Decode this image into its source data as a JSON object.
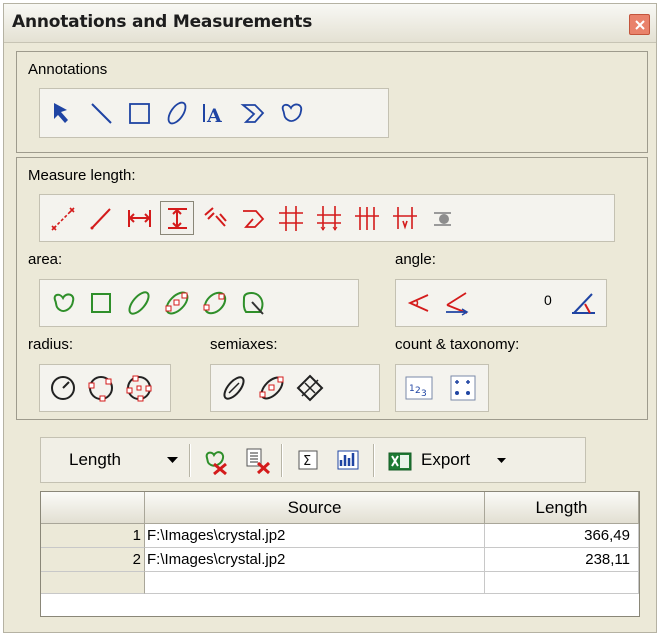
{
  "window": {
    "title": "Annotations and Measurements"
  },
  "annotations": {
    "label": "Annotations"
  },
  "measure": {
    "label": "Measure length:"
  },
  "area": {
    "label": "area:"
  },
  "angle": {
    "label": "angle:",
    "value": "0"
  },
  "radius": {
    "label": "radius:"
  },
  "semiaxes": {
    "label": "semiaxes:"
  },
  "count": {
    "label": "count & taxonomy:"
  },
  "toolbar": {
    "mode": "Length",
    "export_label": "Export"
  },
  "table": {
    "columns": [
      "Source",
      "Length"
    ],
    "rows": [
      {
        "num": "1",
        "source": "F:\\Images\\crystal.jp2",
        "length": "366,49"
      },
      {
        "num": "2",
        "source": "F:\\Images\\crystal.jp2",
        "length": "238,11"
      }
    ]
  },
  "colors": {
    "annotation_icon": "#1f44a3",
    "measure_icon": "#d41b1b",
    "area_icon": "#2f8f2a"
  }
}
